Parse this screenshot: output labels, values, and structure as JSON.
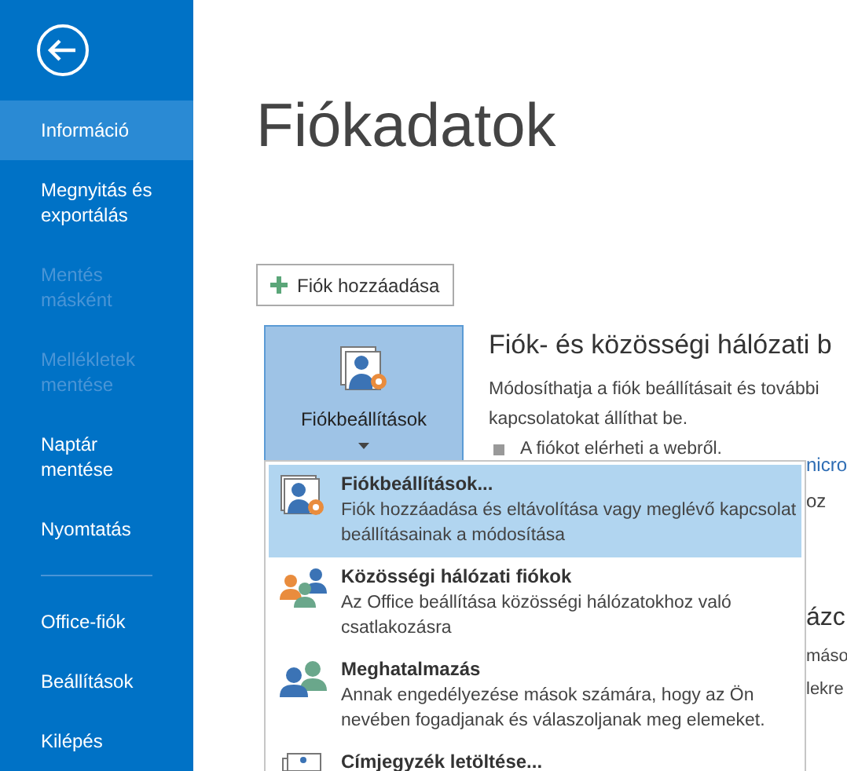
{
  "sidebar": {
    "items": [
      {
        "label": "Információ",
        "selected": true,
        "disabled": false
      },
      {
        "label": "Megnyitás és exportálás",
        "selected": false,
        "disabled": false
      },
      {
        "label": "Mentés másként",
        "selected": false,
        "disabled": true
      },
      {
        "label": "Mellékletek mentése",
        "selected": false,
        "disabled": true
      },
      {
        "label": "Naptár mentése",
        "selected": false,
        "disabled": false
      },
      {
        "label": "Nyomtatás",
        "selected": false,
        "disabled": false,
        "divider_after": true
      },
      {
        "label": "Office-fiók",
        "selected": false,
        "disabled": false
      },
      {
        "label": "Beállítások",
        "selected": false,
        "disabled": false
      },
      {
        "label": "Kilépés",
        "selected": false,
        "disabled": false
      }
    ]
  },
  "page_title": "Fiókadatok",
  "add_account_button": "Fiók hozzáadása",
  "account_settings_button": {
    "label": "Fiókbeállítások"
  },
  "section": {
    "heading": "Fiók- és közösségi hálózati b",
    "description": "Módosíthatja a fiók beállításait és további kapcsolatokat állíthat be.",
    "bullet": "A fiókot elérheti a webről."
  },
  "covered_fragments": [
    "nicro",
    "oz",
    "ázc",
    "máso",
    "lekre"
  ],
  "menu": {
    "items": [
      {
        "kind": "settings",
        "title": "Fiókbeállítások...",
        "description": "Fiók hozzáadása és eltávolítása vagy meglévő kapcsolat beállításainak a módosítása",
        "selected": true
      },
      {
        "kind": "social",
        "title": "Közösségi hálózati fiókok",
        "description": "Az Office beállítása közösségi hálózatokhoz való csatlakozásra",
        "selected": false
      },
      {
        "kind": "delegate",
        "title": "Meghatalmazás",
        "description": "Annak engedélyezése mások számára, hogy az Ön nevében fogadjanak és válaszoljanak meg elemeket.",
        "selected": false
      },
      {
        "kind": "addressbook",
        "title": "Címjegyzék letöltése...",
        "selected": false
      }
    ]
  }
}
